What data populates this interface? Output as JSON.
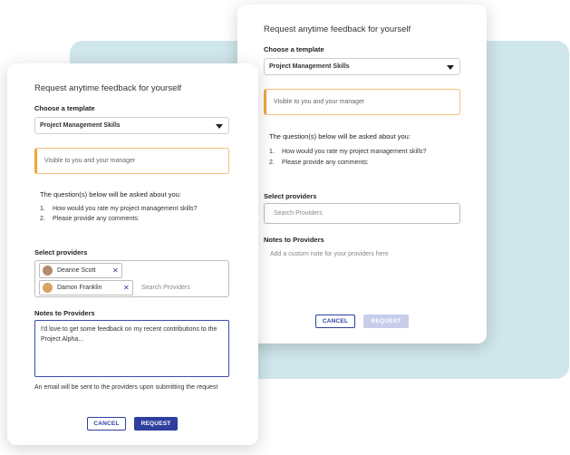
{
  "back_card": {
    "title": "Request anytime feedback for yourself",
    "template_label": "Choose a template",
    "template_value": "Project Management Skills",
    "visibility_text": "Visible to you and your manager",
    "questions_intro": "The question(s) below will be asked about you:",
    "questions": [
      {
        "num": "1.",
        "text": "How would you rate my project management skills?"
      },
      {
        "num": "2.",
        "text": "Please provide any comments:"
      }
    ],
    "providers_label": "Select providers",
    "providers_placeholder": "Search Providers",
    "notes_label": "Notes to Providers",
    "notes_placeholder": "Add a custom note for your providers here",
    "cancel_label": "CANCEL",
    "request_label": "REQUEST"
  },
  "front_card": {
    "title": "Request anytime feedback for yourself",
    "template_label": "Choose a template",
    "template_value": "Project Management Skills",
    "visibility_text": "Visible to you and your manager",
    "questions_intro": "The question(s) below will be asked about you:",
    "questions": [
      {
        "num": "1.",
        "text": "How would you rate my project management skills?"
      },
      {
        "num": "2.",
        "text": "Please provide any comments:"
      }
    ],
    "providers_label": "Select providers",
    "selected_providers": [
      {
        "name": "Deanne Scott",
        "avatar_color": "#b58a6a"
      },
      {
        "name": "Damon Franklin",
        "avatar_color": "#d9a25f"
      }
    ],
    "providers_placeholder": "Search Providers",
    "notes_label": "Notes to Providers",
    "notes_value": "I'd love to get some feedback on my recent contributions to the Project Alpha...",
    "footnote": "An email will be sent to the providers upon submitting the request",
    "cancel_label": "CANCEL",
    "request_label": "REQUEST"
  },
  "colors": {
    "accent": "#2f3f9e",
    "backdrop": "#cfe6eb",
    "visibility_border": "#f0a53a"
  }
}
